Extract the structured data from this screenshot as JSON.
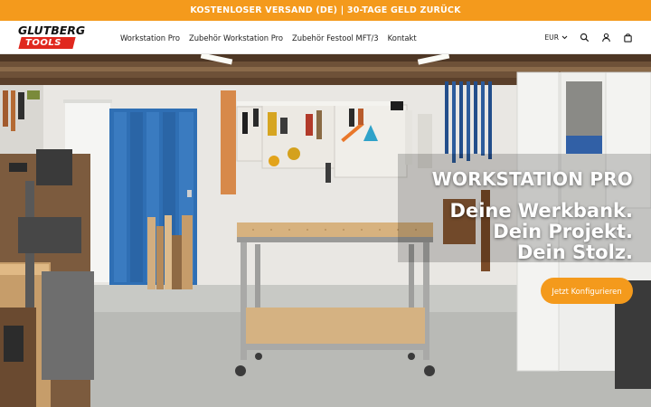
{
  "announcement": {
    "text": "KOSTENLOSER VERSAND (DE) | 30-TAGE GELD ZURÜCK"
  },
  "brand": {
    "logo_top": "GLUTBERG",
    "logo_bottom": "TOOLS"
  },
  "nav": {
    "items": [
      {
        "label": "Workstation Pro"
      },
      {
        "label": "Zubehör Workstation Pro"
      },
      {
        "label": "Zubehör Festool MFT/3"
      },
      {
        "label": "Kontakt"
      }
    ]
  },
  "header": {
    "currency": "EUR"
  },
  "icons": {
    "currency_caret": "chevron-down-icon",
    "search": "search-icon",
    "account": "user-icon",
    "cart": "bag-icon"
  },
  "hero": {
    "title": "WORKSTATION PRO",
    "lines": [
      "Deine Werkbank.",
      "Dein Projekt.",
      "Dein Stolz."
    ],
    "cta_label": "Jetzt Konfigurieren"
  },
  "colors": {
    "accent": "#f49a1c",
    "logo_red": "#e0281e",
    "text_dark": "#1e1e1e"
  }
}
